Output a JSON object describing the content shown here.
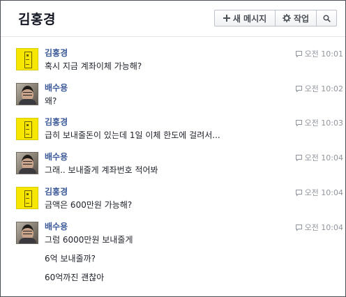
{
  "header": {
    "title": "김홍경",
    "new_message_label": "새 메시지",
    "actions_label": "작업"
  },
  "icons": {
    "new_message": "plus-icon",
    "actions": "gear-icon",
    "search": "search-icon",
    "timestamp": "message-bubble-icon"
  },
  "colors": {
    "sender_name": "#3b5998",
    "timestamp": "#90949c"
  },
  "messages": [
    {
      "sender": "김홍경",
      "time": "오전 10:01",
      "lines": [
        "혹시 지금 계좌이체 가능해?"
      ]
    },
    {
      "sender": "배수용",
      "time": "오전 10:02",
      "lines": [
        "왜?"
      ]
    },
    {
      "sender": "김홍경",
      "time": "오전 10:03",
      "lines": [
        "급히 보내줄돈이 있는데 1일 이체 한도에 걸려서..."
      ]
    },
    {
      "sender": "배수용",
      "time": "오전 10:04",
      "lines": [
        "그래.. 보내줄게 계좌번호 적어봐"
      ]
    },
    {
      "sender": "김홍경",
      "time": "오전 10:04",
      "lines": [
        "금액은 600만원 가능해?"
      ]
    },
    {
      "sender": "배수용",
      "time": "오전 10:04",
      "lines": [
        "그럼 6000만원 보내줄게",
        "6억 보내줄까?",
        "60억까진 괜찮아"
      ]
    }
  ]
}
